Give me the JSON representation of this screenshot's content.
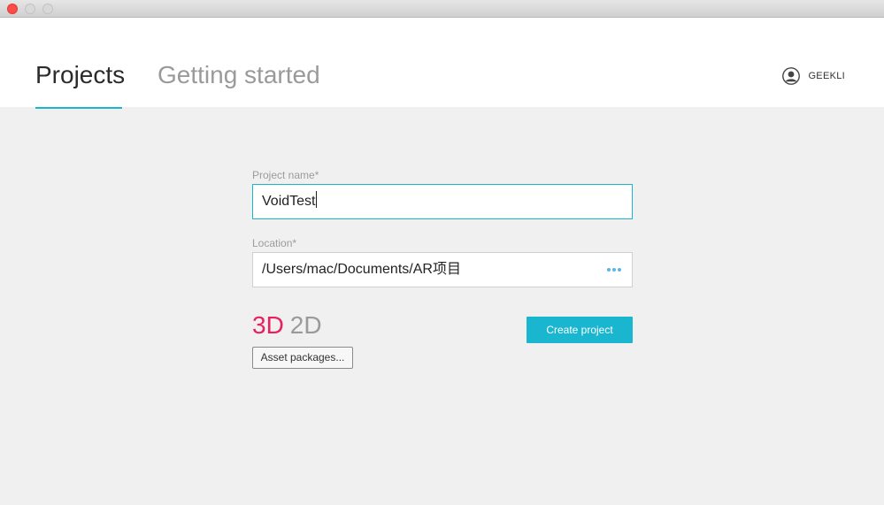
{
  "window": {
    "controls": [
      "close",
      "minimize",
      "maximize"
    ]
  },
  "header": {
    "tabs": [
      {
        "label": "Projects",
        "active": true
      },
      {
        "label": "Getting started",
        "active": false
      }
    ],
    "user": {
      "name": "GEEKLI",
      "icon": "user-avatar-icon"
    },
    "accent_color": "#1ab5cf"
  },
  "form": {
    "project_name": {
      "label": "Project name*",
      "value": "VoidTest"
    },
    "location": {
      "label": "Location*",
      "value": "/Users/mac/Documents/AR项目",
      "browse_icon": "more-dots-icon"
    }
  },
  "dimensions": {
    "options": [
      "3D",
      "2D"
    ],
    "selected": "3D",
    "selected_color": "#e8205d"
  },
  "buttons": {
    "asset_packages": "Asset packages...",
    "create_project": "Create project"
  }
}
